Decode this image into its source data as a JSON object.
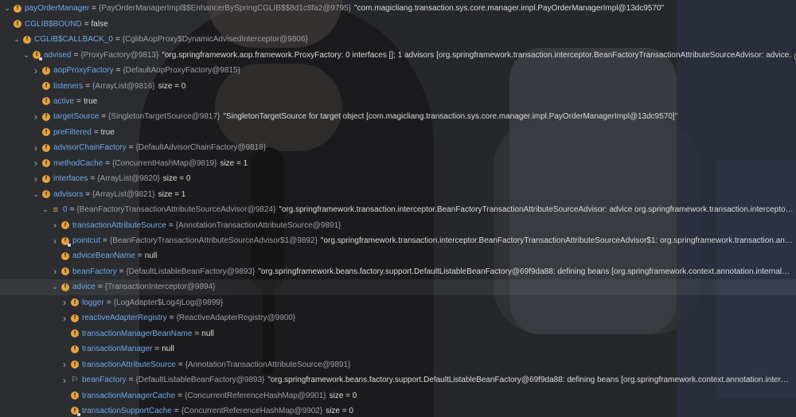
{
  "show_label": "(显示)",
  "rows": [
    {
      "arrow": "down",
      "icon": "f",
      "name": "payOrderManager",
      "type": "{PayOrderManagerImpl$$EnhancerBySpringCGLIB$$8d1c8fa2@9795}",
      "value": "",
      "size": "",
      "string": "\"com.magicliang.transaction.sys.core.manager.impl.PayOrderManagerImpl@13dc9570\"",
      "show": false
    },
    {
      "arrow": "none",
      "icon": "f",
      "name": "CGLIB$BOUND",
      "type": "",
      "value": "false",
      "size": "",
      "string": "",
      "show": false
    },
    {
      "arrow": "down",
      "icon": "f",
      "name": "CGLIB$CALLBACK_0",
      "type": "{CglibAopProxy$DynamicAdvisedInterceptor@9806}",
      "value": "",
      "size": "",
      "string": "",
      "show": false
    },
    {
      "arrow": "down",
      "icon": "lock",
      "name": "advised",
      "type": "{ProxyFactory@9813}",
      "value": "",
      "size": "",
      "string": "\"org.springframework.aop.framework.ProxyFactory: 0 interfaces []; 1 advisors [org.springframework.transaction.interceptor.BeanFactoryTransactionAttributeSourceAdvisor: advice…",
      "show": true
    },
    {
      "arrow": "right",
      "icon": "f",
      "name": "aopProxyFactory",
      "type": "{DefaultAopProxyFactory@9815}",
      "value": "",
      "size": "",
      "string": "",
      "show": false
    },
    {
      "arrow": "none",
      "icon": "f",
      "name": "listeners",
      "type": "{ArrayList@9816}",
      "value": "",
      "size": "size = 0",
      "string": "",
      "show": false
    },
    {
      "arrow": "none",
      "icon": "f",
      "name": "active",
      "type": "",
      "value": "true",
      "size": "",
      "string": "",
      "show": false
    },
    {
      "arrow": "right",
      "icon": "f",
      "name": "targetSource",
      "type": "{SingletonTargetSource@9817}",
      "value": "",
      "size": "",
      "string": "\"SingletonTargetSource for target object [com.magicliang.transaction.sys.core.manager.impl.PayOrderManagerImpl@13dc9570]\"",
      "show": false
    },
    {
      "arrow": "none",
      "icon": "f",
      "name": "preFiltered",
      "type": "",
      "value": "true",
      "size": "",
      "string": "",
      "show": false
    },
    {
      "arrow": "right",
      "icon": "f",
      "name": "advisorChainFactory",
      "type": "{DefaultAdvisorChainFactory@9818}",
      "value": "",
      "size": "",
      "string": "",
      "show": false
    },
    {
      "arrow": "right",
      "icon": "f",
      "name": "methodCache",
      "type": "{ConcurrentHashMap@9819}",
      "value": "",
      "size": "size = 1",
      "string": "",
      "show": false
    },
    {
      "arrow": "right",
      "icon": "f",
      "name": "interfaces",
      "type": "{ArrayList@9820}",
      "value": "",
      "size": "size = 0",
      "string": "",
      "show": false
    },
    {
      "arrow": "down",
      "icon": "f",
      "name": "advisors",
      "type": "{ArrayList@9821}",
      "value": "",
      "size": "size = 1",
      "string": "",
      "show": false
    },
    {
      "arrow": "down",
      "icon": "list",
      "name": "0",
      "type": "{BeanFactoryTransactionAttributeSourceAdvisor@9824}",
      "value": "",
      "size": "",
      "string": "\"org.springframework.transaction.interceptor.BeanFactoryTransactionAttributeSourceAdvisor: advice org.springframework.transaction.intercepto…",
      "show": true
    },
    {
      "arrow": "right",
      "icon": "f",
      "name": "transactionAttributeSource",
      "type": "{AnnotationTransactionAttributeSource@9891}",
      "value": "",
      "size": "",
      "string": "",
      "show": false
    },
    {
      "arrow": "right",
      "icon": "lock",
      "name": "pointcut",
      "type": "{BeanFactoryTransactionAttributeSourceAdvisor$1@9892}",
      "value": "",
      "size": "",
      "string": "\"org.springframework.transaction.interceptor.BeanFactoryTransactionAttributeSourceAdvisor$1: org.springframework.transaction.an…",
      "show": true
    },
    {
      "arrow": "none",
      "icon": "f",
      "name": "adviceBeanName",
      "type": "",
      "value": "null",
      "size": "",
      "string": "",
      "show": false
    },
    {
      "arrow": "right",
      "icon": "f",
      "name": "beanFactory",
      "type": "{DefaultListableBeanFactory@9893}",
      "value": "",
      "size": "",
      "string": "\"org.springframework.beans.factory.support.DefaultListableBeanFactory@69f9da88: defining beans [org.springframework.context.annotation.internal…",
      "show": true
    },
    {
      "arrow": "down",
      "icon": "f",
      "name": "advice",
      "type": "{TransactionInterceptor@9894}",
      "value": "",
      "size": "",
      "string": "",
      "show": false
    },
    {
      "arrow": "right",
      "icon": "f",
      "name": "logger",
      "type": "{LogAdapter$Log4jLog@9899}",
      "value": "",
      "size": "",
      "string": "",
      "show": false
    },
    {
      "arrow": "right",
      "icon": "f",
      "name": "reactiveAdapterRegistry",
      "type": "{ReactiveAdapterRegistry@9900}",
      "value": "",
      "size": "",
      "string": "",
      "show": false
    },
    {
      "arrow": "none",
      "icon": "f",
      "name": "transactionManagerBeanName",
      "type": "",
      "value": "null",
      "size": "",
      "string": "",
      "show": false
    },
    {
      "arrow": "none",
      "icon": "f",
      "name": "transactionManager",
      "type": "",
      "value": "null",
      "size": "",
      "string": "",
      "show": false
    },
    {
      "arrow": "right",
      "icon": "f",
      "name": "transactionAttributeSource",
      "type": "{AnnotationTransactionAttributeSource@9891}",
      "value": "",
      "size": "",
      "string": "",
      "show": false
    },
    {
      "arrow": "right",
      "icon": "flag",
      "name": "beanFactory",
      "type": "{DefaultListableBeanFactory@9893}",
      "value": "",
      "size": "",
      "string": "\"org.springframework.beans.factory.support.DefaultListableBeanFactory@69f9da88: defining beans [org.springframework.context.annotation.inter…",
      "show": true
    },
    {
      "arrow": "none",
      "icon": "f",
      "name": "transactionManagerCache",
      "type": "{ConcurrentReferenceHashMap@9901}",
      "value": "",
      "size": "size = 0",
      "string": "",
      "show": false
    },
    {
      "arrow": "none",
      "icon": "lock",
      "name": "transactionSupportCache",
      "type": "{ConcurrentReferenceHashMap@9902}",
      "value": "",
      "size": "size = 0",
      "string": "",
      "show": false
    }
  ]
}
